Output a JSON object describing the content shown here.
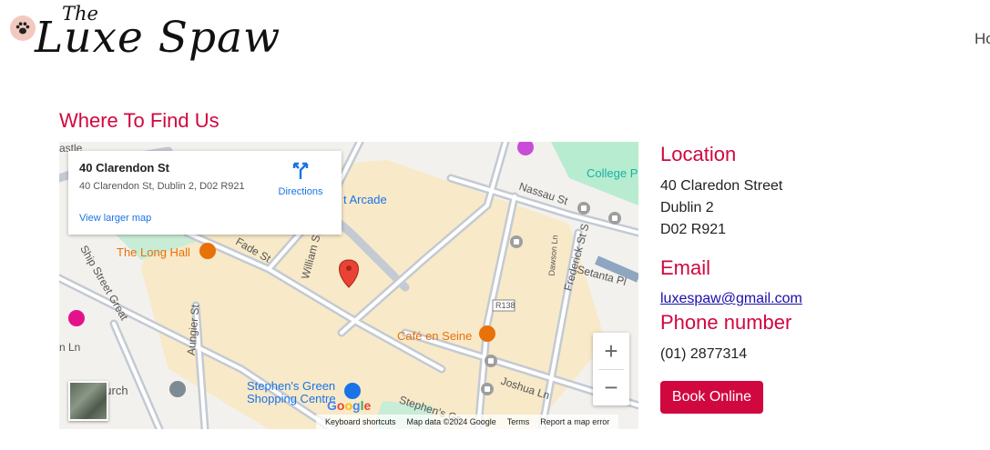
{
  "brand": {
    "logo_small": "The",
    "logo_big": "Luxe Spaw",
    "accent": "#d1073f"
  },
  "nav": {
    "items": [
      {
        "label": "Ho"
      }
    ]
  },
  "section": {
    "title": "Where To Find Us"
  },
  "map": {
    "infocard": {
      "title": "40 Clarendon St",
      "address": "40 Clarendon St, Dublin 2, D02 R921",
      "directions": "Directions",
      "larger_map": "View larger map"
    },
    "pois": [
      {
        "label": "The Long Hall",
        "color": "#e8710a"
      },
      {
        "label": "Café en Seine",
        "color": "#e8710a"
      },
      {
        "label": "Stephen's Green Shopping Centre",
        "color": "#1a73e8"
      },
      {
        "label": "College P",
        "color": "#12b5a0"
      },
      {
        "label": "t Arcade",
        "color": "#1a73e8"
      },
      {
        "label": "eet Church",
        "color": "#555555"
      }
    ],
    "streets": [
      "Nassau St",
      "Fade St",
      "William St",
      "Ship Street Great",
      "Aungier St",
      "Frederick St S",
      "Setanta Pl",
      "Dawson Ln",
      "Joshua Ln",
      "Stephen's Gr",
      "R138",
      "astle",
      "n Ln"
    ],
    "zoom": {
      "in": "+",
      "out": "−"
    },
    "google": "Google",
    "attribution": {
      "shortcuts": "Keyboard shortcuts",
      "data": "Map data ©2024 Google",
      "terms": "Terms",
      "report": "Report a map error"
    }
  },
  "info": {
    "location_heading": "Location",
    "address_lines": [
      "40 Claredon Street",
      "Dublin 2",
      "D02 R921"
    ],
    "email_heading": "Email",
    "email": "luxespaw@gmail.com",
    "phone_heading": "Phone number",
    "phone": "(01) 2877314",
    "book_button": "Book Online"
  }
}
